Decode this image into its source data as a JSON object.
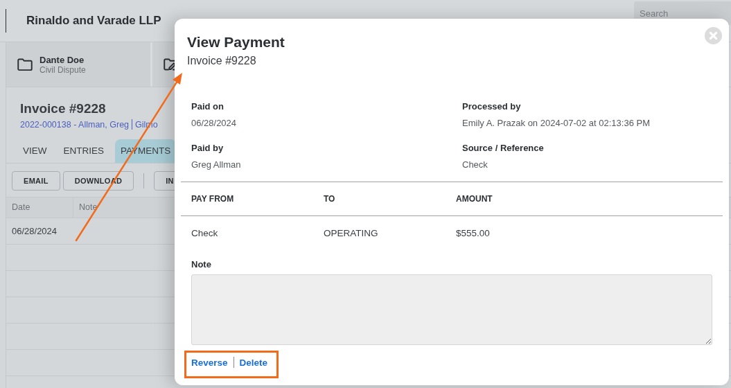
{
  "app": {
    "firm_name": "Rinaldo and Varade LLP",
    "search": {
      "placeholder": "Search"
    },
    "matters": [
      {
        "kind": "folder",
        "name": "Dante Doe",
        "type": "Civil Dispute"
      },
      {
        "kind": "folder-pen"
      }
    ],
    "invoice": {
      "title": "Invoice #9228",
      "links": [
        "2022-000138 - Allman, Greg",
        "Gilmo"
      ]
    },
    "tabs": [
      {
        "label": "VIEW",
        "selected": false
      },
      {
        "label": "ENTRIES",
        "selected": false
      },
      {
        "label": "PAYMENTS",
        "selected": true
      }
    ],
    "toolbar": {
      "groups": [
        [
          "EMAIL",
          "DOWNLOAD"
        ],
        [
          "IN"
        ]
      ]
    },
    "table": {
      "columns": [
        "Date",
        "Note"
      ],
      "rows": [
        [
          "06/28/2024"
        ]
      ]
    }
  },
  "modal": {
    "title": "View Payment",
    "subtitle": "Invoice #9228",
    "details": [
      {
        "label": "Paid on",
        "value": "06/28/2024"
      },
      {
        "label": "Processed by",
        "value": "Emily A. Prazak on 2024-07-02 at 02:13:36 PM"
      },
      {
        "label": "Paid by",
        "value": "Greg Allman"
      },
      {
        "label": "Source / Reference",
        "value": "Check"
      }
    ],
    "allocations": {
      "columns": [
        "PAY FROM",
        "TO",
        "AMOUNT"
      ],
      "rows": [
        [
          "Check",
          "OPERATING",
          "$555.00"
        ]
      ]
    },
    "note_label": "Note",
    "actions": [
      "Reverse",
      "Delete"
    ]
  }
}
